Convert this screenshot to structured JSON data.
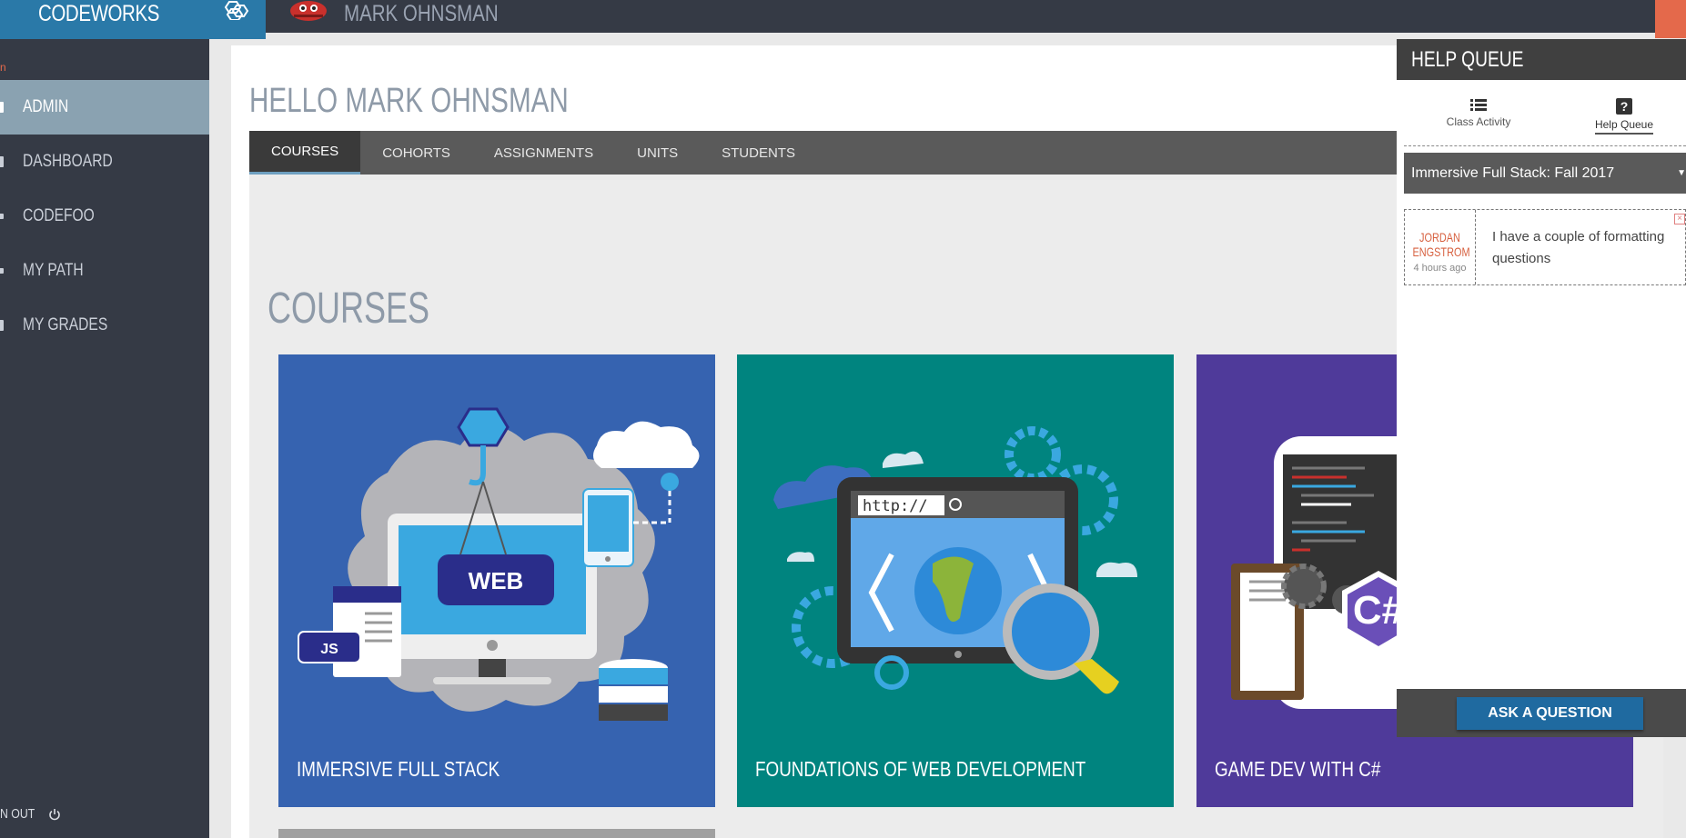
{
  "topbar": {
    "brand": "CODEWORKS",
    "user": "MARK OHNSMAN"
  },
  "sidebar": {
    "mini_label": "n",
    "items": [
      {
        "label": "ADMIN",
        "active": true
      },
      {
        "label": "DASHBOARD",
        "active": false
      },
      {
        "label": "CODEFOO",
        "active": false
      },
      {
        "label": "MY PATH",
        "active": false
      },
      {
        "label": "MY GRADES",
        "active": false
      }
    ],
    "logout_label": "N OUT"
  },
  "main": {
    "greeting": "HELLO MARK OHNSMAN",
    "tabs": [
      {
        "label": "COURSES",
        "active": true
      },
      {
        "label": "COHORTS",
        "active": false
      },
      {
        "label": "ASSIGNMENTS",
        "active": false
      },
      {
        "label": "UNITS",
        "active": false
      },
      {
        "label": "STUDENTS",
        "active": false
      }
    ],
    "section_title": "COURSES",
    "courses": [
      {
        "title": "IMMERSIVE FULL STACK",
        "art_text": "WEB",
        "art_badge": "JS",
        "color": "#3663b0"
      },
      {
        "title": "FOUNDATIONS OF WEB DEVELOPMENT",
        "art_text": "http://",
        "color": "#00847f"
      },
      {
        "title": "GAME DEV WITH C#",
        "art_text": "C#",
        "color": "#4f3a9a"
      }
    ]
  },
  "help_queue": {
    "title": "HELP QUEUE",
    "tabs": [
      {
        "label": "Class Activity",
        "icon": "list-icon",
        "active": false
      },
      {
        "label": "Help Queue",
        "icon": "question-icon",
        "active": true
      }
    ],
    "cohort_select": "Immersive Full Stack: Fall 2017",
    "items": [
      {
        "name_line1": "JORDAN",
        "name_line2": "ENGSTROM",
        "time": "4 hours ago",
        "message": "I have a couple of formatting questions"
      }
    ],
    "ask_button": "ASK A QUESTION"
  }
}
